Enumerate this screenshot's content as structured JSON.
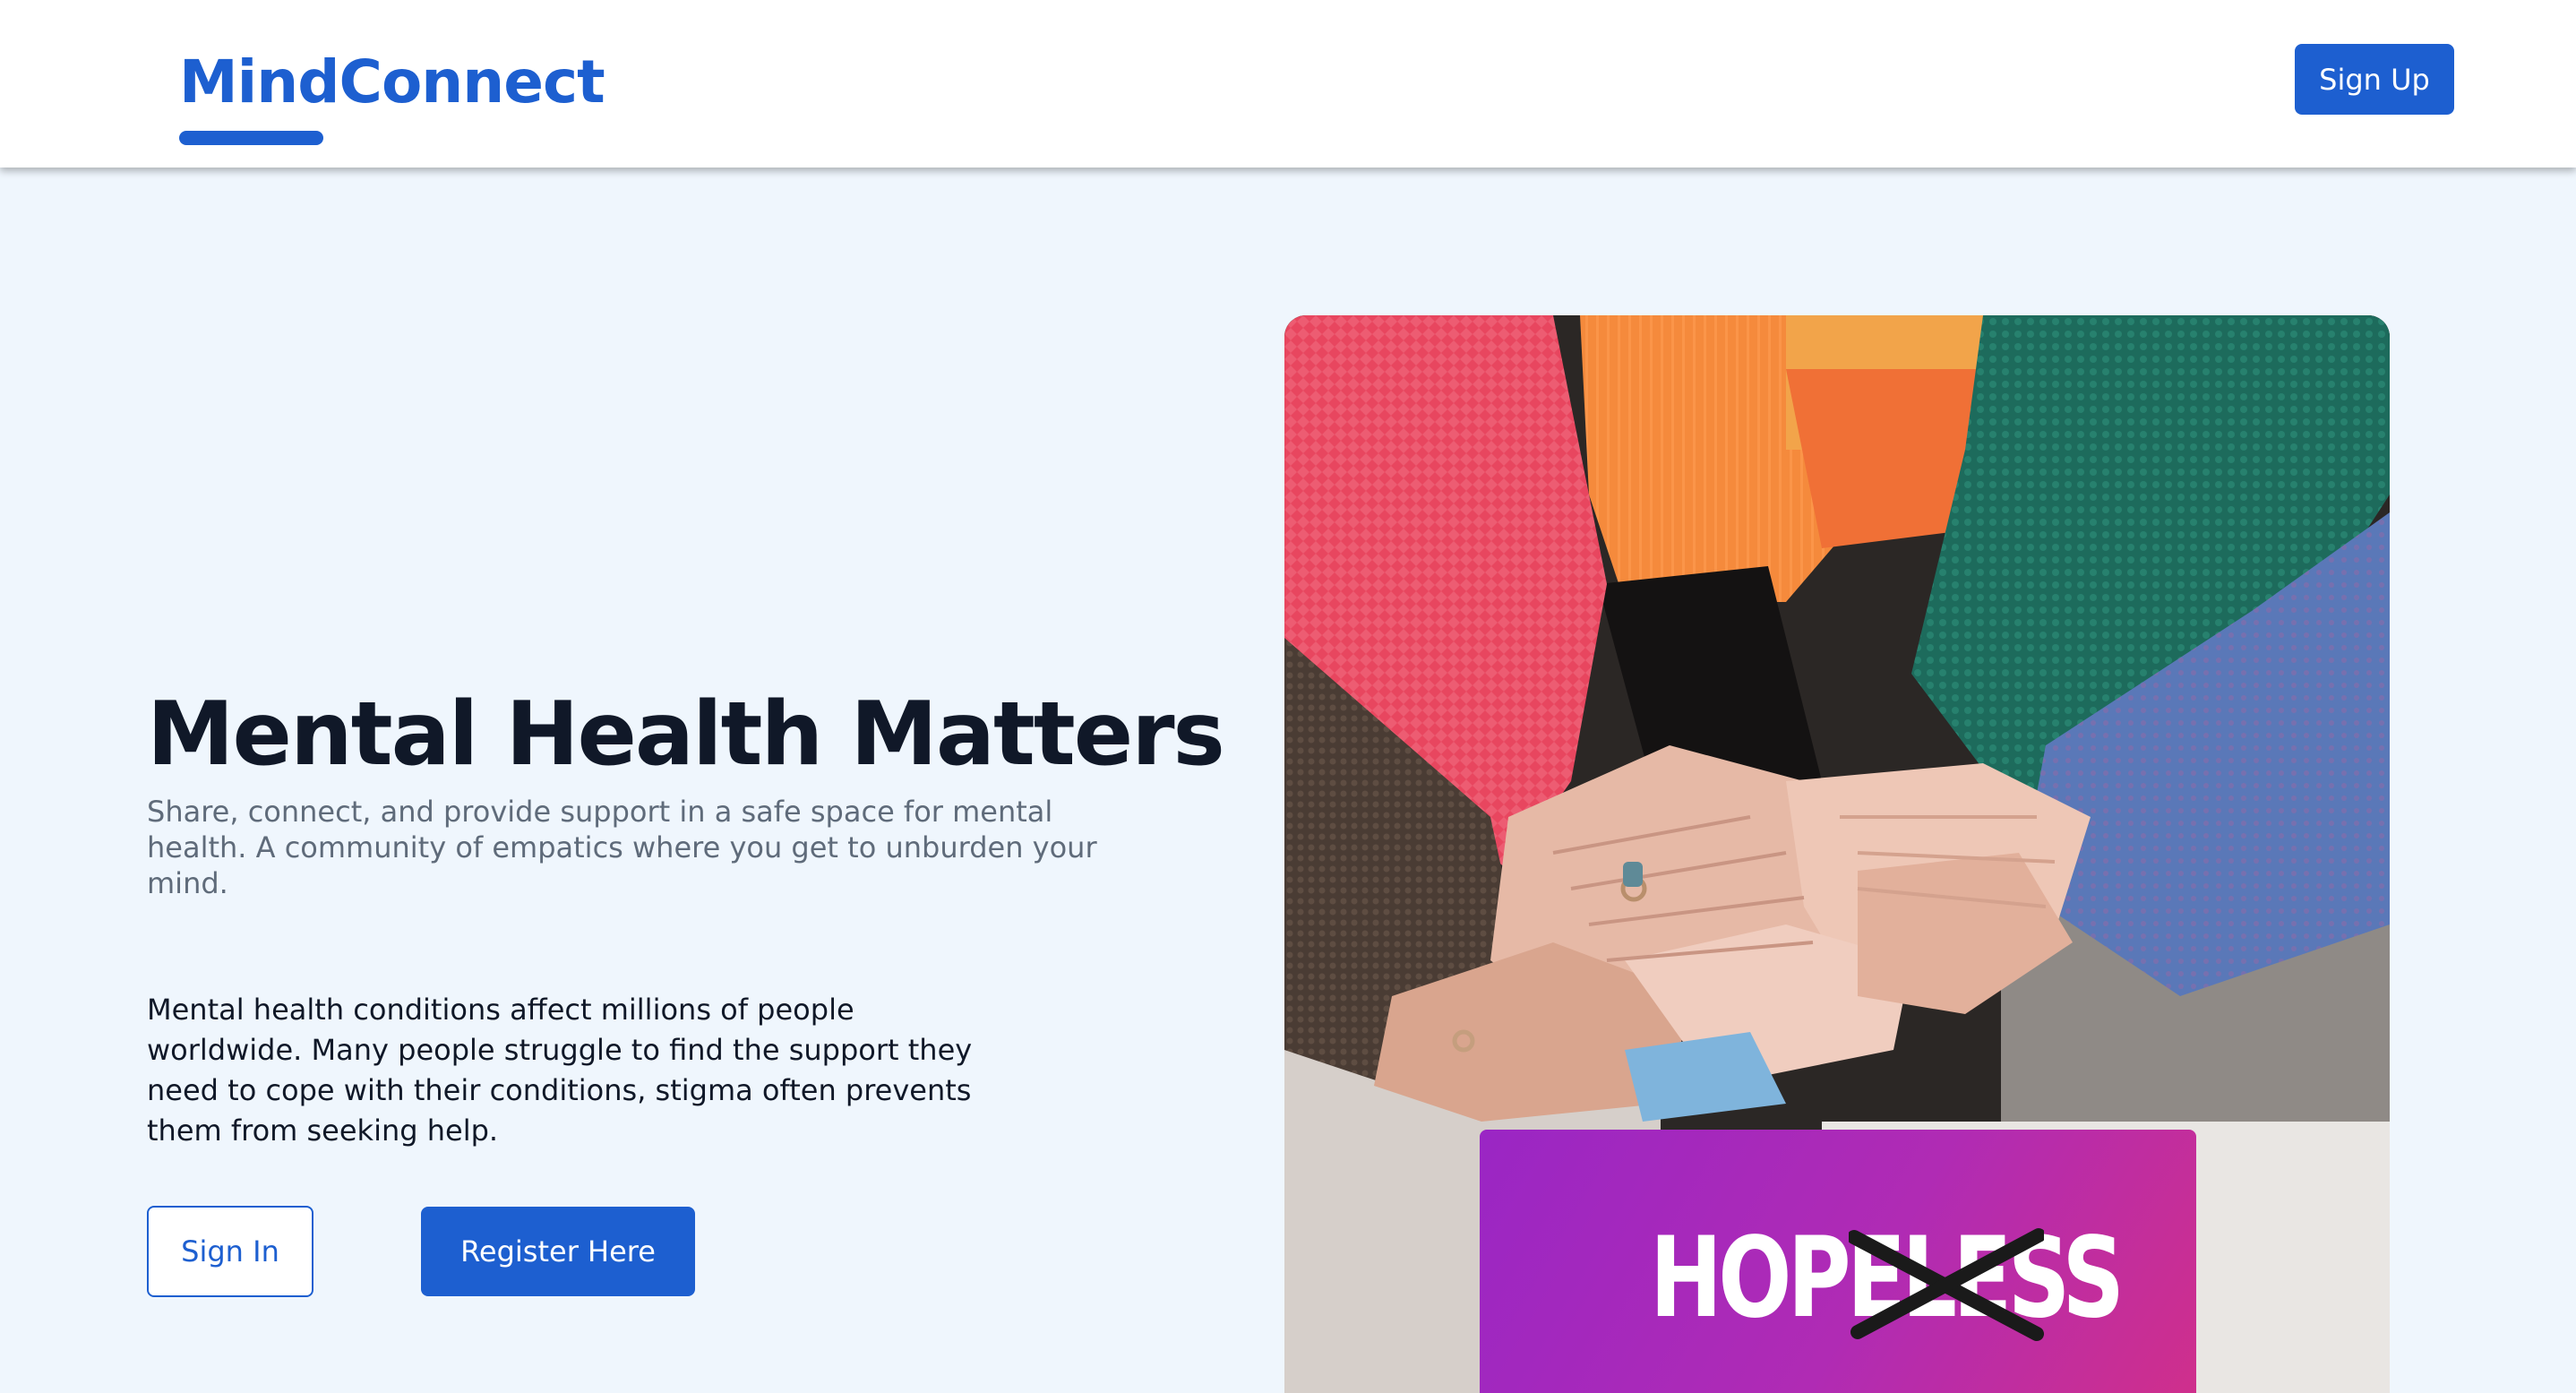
{
  "header": {
    "brand": "MindConnect",
    "signup_label": "Sign Up"
  },
  "hero": {
    "title": "Mental Health Matters",
    "subtitle": "Share, connect, and provide support in a safe space for mental health. A community of empatics where you get to unburden your mind.",
    "body": "Mental health conditions affect millions of people worldwide. Many people struggle to find the support they need to cope with their conditions, stigma often prevents them from seeking help.",
    "signin_label": "Sign In",
    "register_label": "Register Here"
  },
  "image": {
    "description": "hands-stacked-photo",
    "overlay_text": "HOPELESS"
  },
  "colors": {
    "brand": "#1d5fd0",
    "page_background": "#eff6fd",
    "header_background": "#ffffff",
    "title_text": "#101828",
    "subtitle_text": "#5f6b7a",
    "hope_card_start": "#9a26c4",
    "hope_card_end": "#cf2f8c"
  }
}
